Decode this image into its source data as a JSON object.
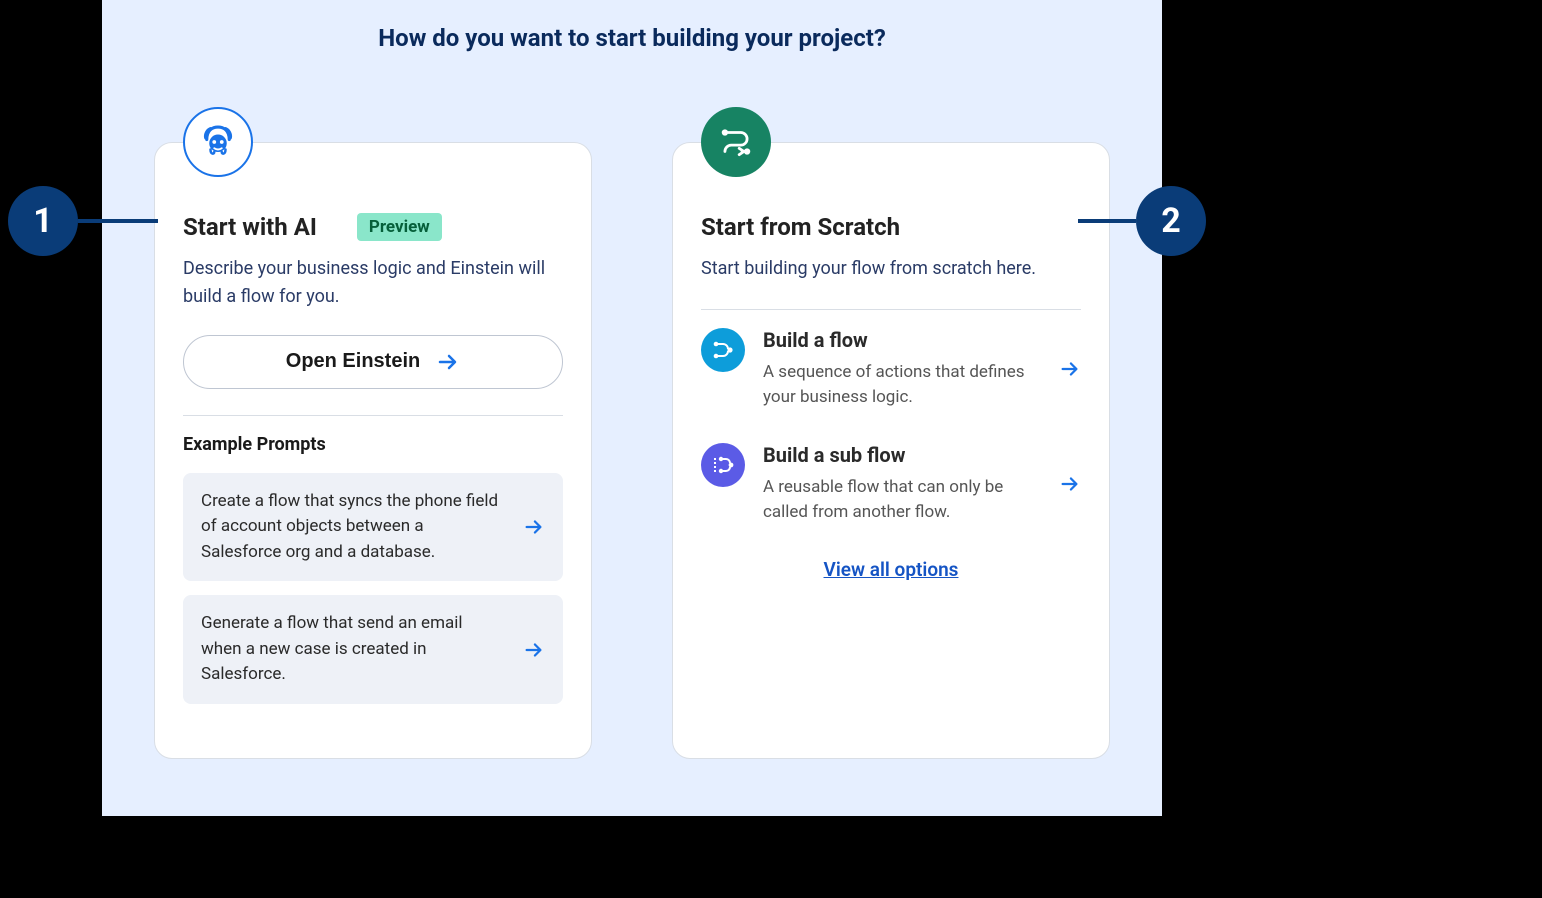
{
  "page": {
    "title": "How do you want to start building your project?"
  },
  "callouts": {
    "one": "1",
    "two": "2"
  },
  "ai_card": {
    "title": "Start with AI",
    "badge": "Preview",
    "description": "Describe your business logic and Einstein will build a flow for you.",
    "button_label": "Open Einstein",
    "example_header": "Example Prompts",
    "prompts": [
      "Create a flow that syncs the phone field of account objects between a Salesforce org and a database.",
      "Generate a flow that send an email when a new case is created in Salesforce."
    ]
  },
  "scratch_card": {
    "title": "Start from Scratch",
    "description": "Start building your flow from scratch here.",
    "options": [
      {
        "title": "Build a flow",
        "description": "A sequence of actions that defines your business logic."
      },
      {
        "title": "Build a sub flow",
        "description": "A reusable flow that can only be called from another flow."
      }
    ],
    "view_all_label": "View all options"
  }
}
